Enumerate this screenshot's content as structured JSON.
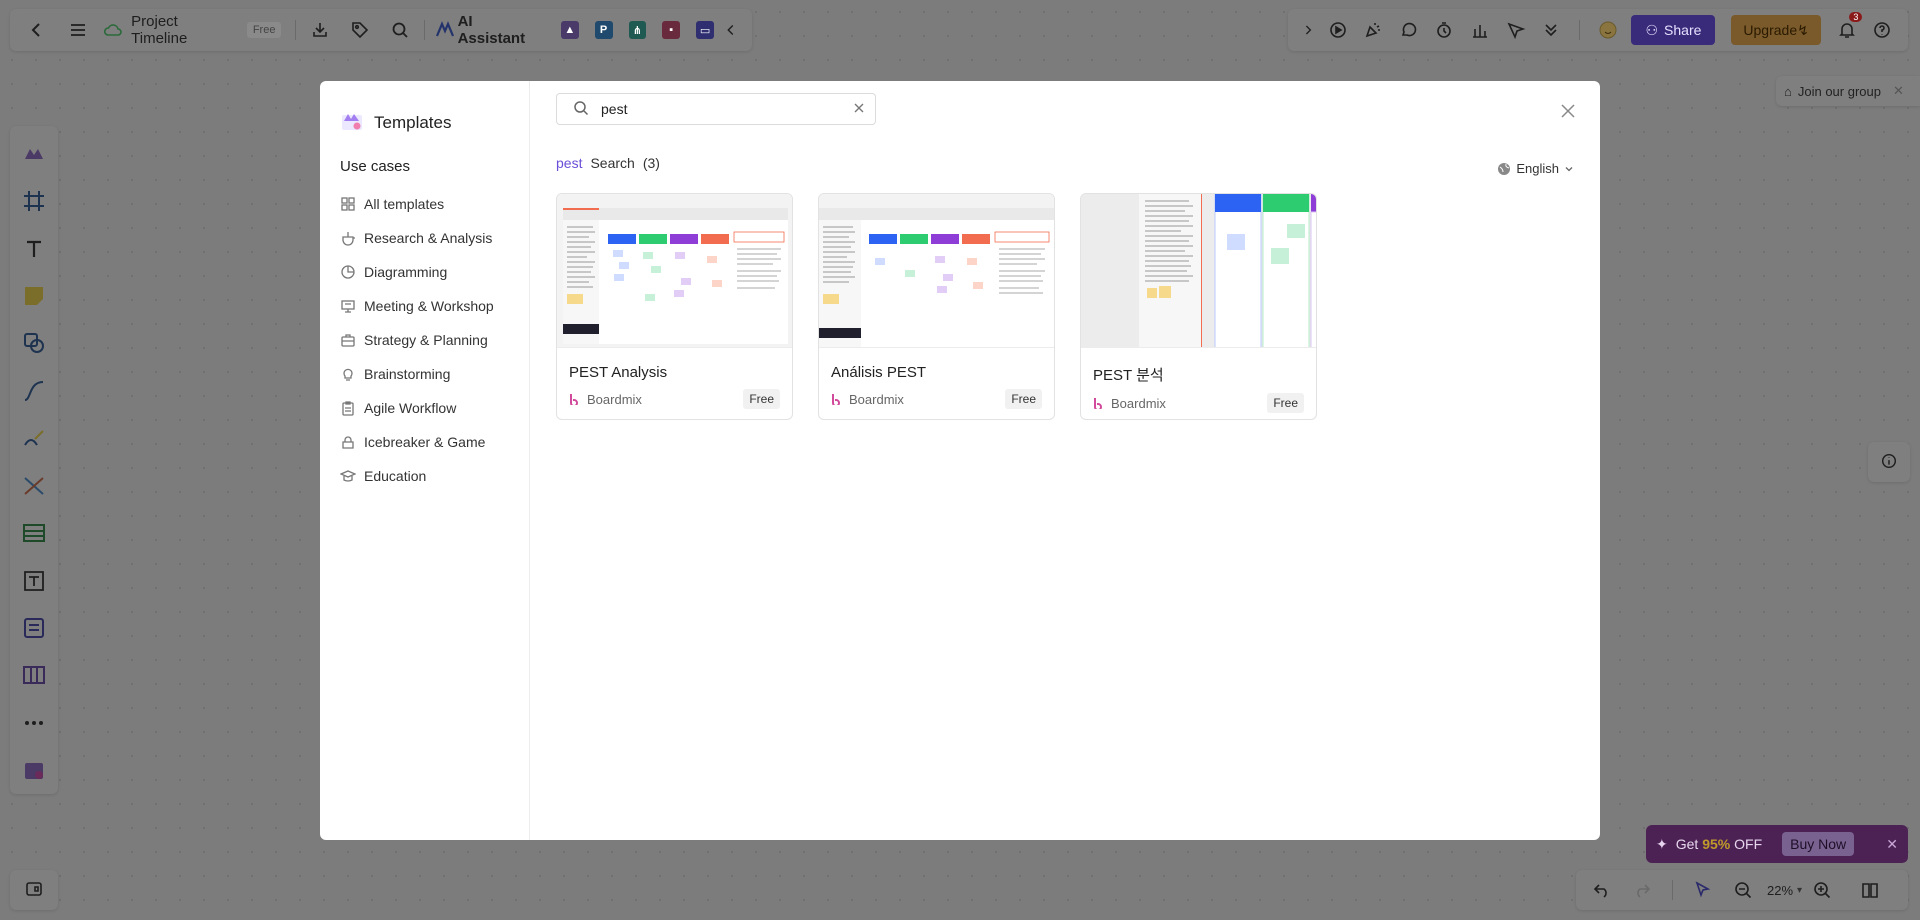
{
  "topbar": {
    "project_title": "Project Timeline",
    "plan_badge": "Free",
    "ai_assistant_label": "AI Assistant"
  },
  "topbar_right": {
    "share_label": "Share",
    "upgrade_label": "Upgrade",
    "notification_count": "3"
  },
  "join_group_label": "Join our group",
  "promo": {
    "text_prefix": "Get ",
    "percent": "95%",
    "text_suffix": " OFF",
    "buy_label": "Buy Now"
  },
  "zoom_level": "22%",
  "modal": {
    "title": "Templates",
    "sidebar_heading": "Use cases",
    "categories": [
      {
        "label": "All templates",
        "icon": "grid-icon"
      },
      {
        "label": "Research & Analysis",
        "icon": "flask-icon"
      },
      {
        "label": "Diagramming",
        "icon": "pie-icon"
      },
      {
        "label": "Meeting & Workshop",
        "icon": "presentation-icon"
      },
      {
        "label": "Strategy & Planning",
        "icon": "briefcase-icon"
      },
      {
        "label": "Brainstorming",
        "icon": "lightbulb-icon"
      },
      {
        "label": "Agile Workflow",
        "icon": "clipboard-icon"
      },
      {
        "label": "Icebreaker & Game",
        "icon": "puzzle-icon"
      },
      {
        "label": "Education",
        "icon": "graduation-icon"
      }
    ],
    "search_value": "pest",
    "results_query": "pest",
    "results_label": "Search",
    "results_count": "(3)",
    "language": "English",
    "cards": [
      {
        "title": "PEST Analysis",
        "author": "Boardmix",
        "badge": "Free"
      },
      {
        "title": "Análisis PEST",
        "author": "Boardmix",
        "badge": "Free"
      },
      {
        "title": "PEST 분석",
        "author": "Boardmix",
        "badge": "Free"
      }
    ]
  }
}
